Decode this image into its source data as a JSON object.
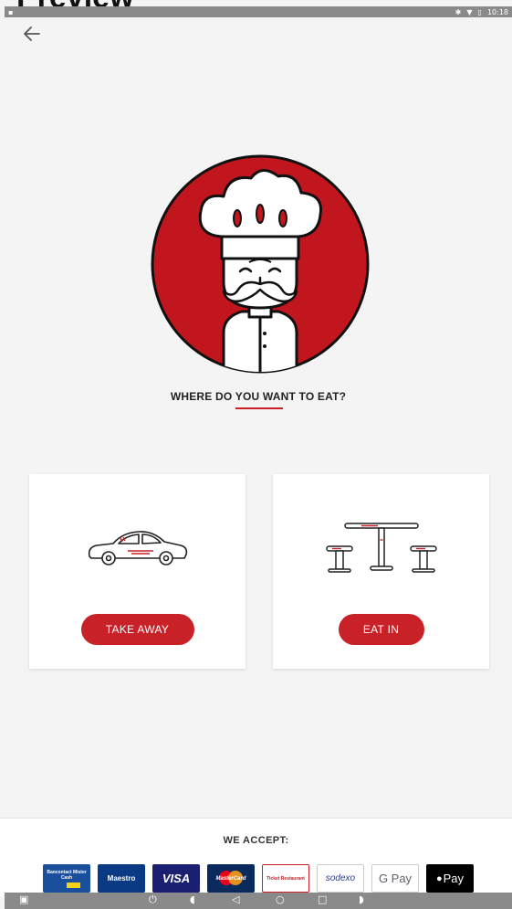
{
  "overlay": {
    "preview_label": "Preview"
  },
  "statusbar": {
    "time": "10:18",
    "icons": [
      "bluetooth-icon",
      "wifi-icon",
      "battery-icon"
    ]
  },
  "main": {
    "question": "WHERE DO YOU WANT TO EAT?",
    "options": [
      {
        "label": "TAKE AWAY",
        "icon": "car-icon"
      },
      {
        "label": "EAT IN",
        "icon": "table-stools-icon"
      }
    ]
  },
  "footer": {
    "accept_label": "WE ACCEPT:",
    "payment_methods": [
      {
        "label": "Bancontact Mister Cash",
        "bg": "#1a4f9c",
        "color": "#ffffff"
      },
      {
        "label": "Maestro",
        "bg": "#0b3a85",
        "color": "#ffffff"
      },
      {
        "label": "VISA",
        "bg": "#1a1f71",
        "color": "#ffffff"
      },
      {
        "label": "MasterCard",
        "bg": "#0a2a5e",
        "color": "#ffffff"
      },
      {
        "label": "Ticket Restaurant",
        "bg": "#ffffff",
        "color": "#c82128"
      },
      {
        "label": "sodexo",
        "bg": "#ffffff",
        "color": "#2a3a8a"
      },
      {
        "label": "G Pay",
        "bg": "#ffffff",
        "color": "#5f6368"
      },
      {
        "label": "Pay",
        "bg": "#000000",
        "color": "#ffffff"
      }
    ]
  },
  "colors": {
    "accent": "#c82128",
    "background": "#f4f4f4",
    "card": "#ffffff"
  }
}
